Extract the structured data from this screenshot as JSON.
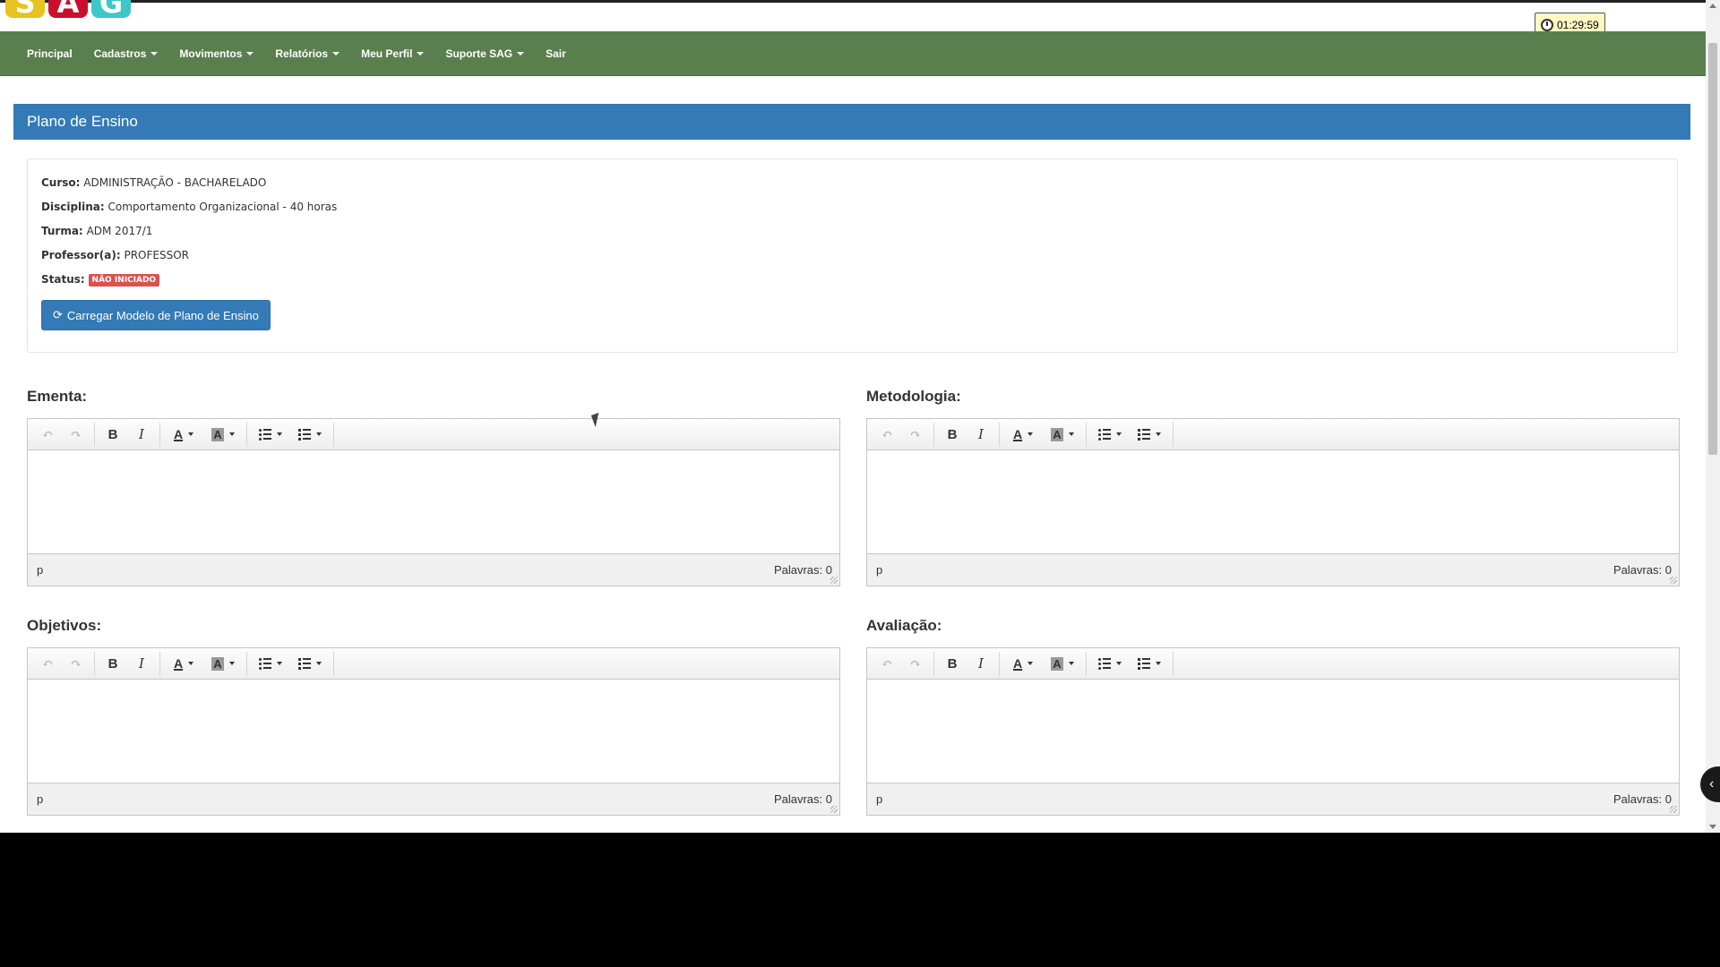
{
  "logo": {
    "letters": [
      "S",
      "A",
      "G"
    ],
    "colors": [
      "#e6c31e",
      "#c8102e",
      "#3ec7c9"
    ]
  },
  "timer": {
    "time": "01:29:59"
  },
  "nav": {
    "items": [
      {
        "label": "Principal",
        "dropdown": false
      },
      {
        "label": "Cadastros",
        "dropdown": true
      },
      {
        "label": "Movimentos",
        "dropdown": true
      },
      {
        "label": "Relatórios",
        "dropdown": true
      },
      {
        "label": "Meu Perfil",
        "dropdown": true
      },
      {
        "label": "Suporte SAG",
        "dropdown": true
      },
      {
        "label": "Sair",
        "dropdown": false
      }
    ]
  },
  "page": {
    "title": "Plano de Ensino"
  },
  "info": {
    "curso_label": "Curso:",
    "curso_value": "ADMINISTRAÇÃO - BACHARELADO",
    "disciplina_label": "Disciplina:",
    "disciplina_value": "Comportamento Organizacional - 40 horas",
    "turma_label": "Turma:",
    "turma_value": "ADM 2017/1",
    "professor_label": "Professor(a):",
    "professor_value": "PROFESSOR",
    "status_label": "Status:",
    "status_value": "NÃO INICIADO",
    "load_button": "Carregar Modelo de Plano de Ensino"
  },
  "editors": {
    "ementa": {
      "title": "Ementa:",
      "path": "p",
      "words": "Palavras: 0"
    },
    "metodologia": {
      "title": "Metodologia:",
      "path": "p",
      "words": "Palavras: 0"
    },
    "objetivos": {
      "title": "Objetivos:",
      "path": "p",
      "words": "Palavras: 0"
    },
    "avaliacao": {
      "title": "Avaliação:",
      "path": "p",
      "words": "Palavras: 0"
    }
  },
  "toolbar": {
    "bold": "B",
    "italic": "I",
    "font_color": "A",
    "bg_color": "A",
    "undo": "↶",
    "redo": "↷"
  },
  "colors": {
    "navbar": "#5a7f4e",
    "primary": "#337ab7",
    "status_badge": "#d9534f"
  }
}
